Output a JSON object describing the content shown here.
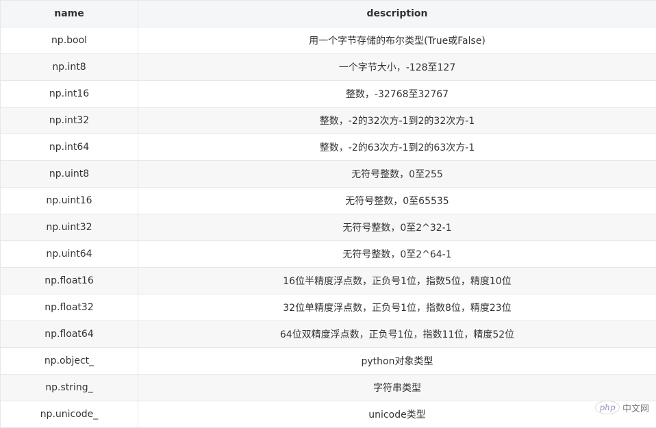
{
  "table": {
    "headers": {
      "name": "name",
      "description": "description"
    },
    "rows": [
      {
        "name": "np.bool",
        "description": "用一个字节存储的布尔类型(True或False)"
      },
      {
        "name": "np.int8",
        "description": "一个字节大小，-128至127"
      },
      {
        "name": "np.int16",
        "description": "整数，-32768至32767"
      },
      {
        "name": "np.int32",
        "description": "整数，-2的32次方-1到2的32次方-1"
      },
      {
        "name": "np.int64",
        "description": "整数，-2的63次方-1到2的63次方-1"
      },
      {
        "name": "np.uint8",
        "description": "无符号整数，0至255"
      },
      {
        "name": "np.uint16",
        "description": "无符号整数，0至65535"
      },
      {
        "name": "np.uint32",
        "description": "无符号整数，0至2^32-1"
      },
      {
        "name": "np.uint64",
        "description": "无符号整数，0至2^64-1"
      },
      {
        "name": "np.float16",
        "description": "16位半精度浮点数，正负号1位，指数5位，精度10位"
      },
      {
        "name": "np.float32",
        "description": "32位单精度浮点数，正负号1位，指数8位，精度23位"
      },
      {
        "name": "np.float64",
        "description": "64位双精度浮点数，正负号1位，指数11位，精度52位"
      },
      {
        "name": "np.object_",
        "description": "python对象类型"
      },
      {
        "name": "np.string_",
        "description": "字符串类型"
      },
      {
        "name": "np.unicode_",
        "description": "unicode类型"
      }
    ]
  },
  "watermark": {
    "logo_text": "php",
    "site_text": "中文网"
  }
}
